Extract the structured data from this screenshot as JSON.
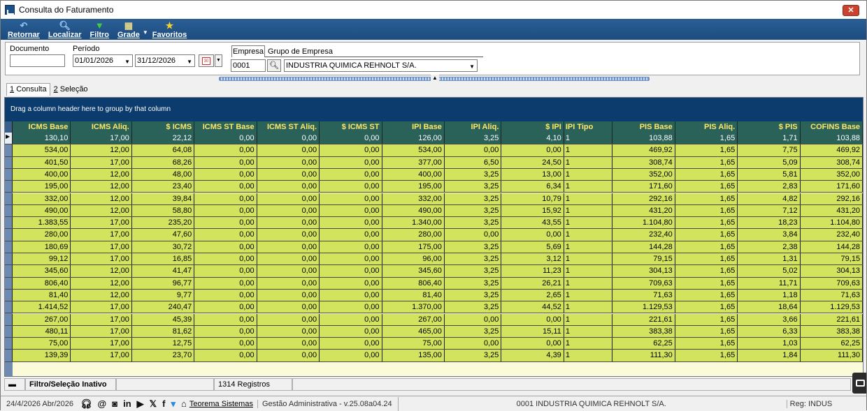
{
  "window": {
    "title": "Consulta do Faturamento",
    "close": "✕"
  },
  "toolbar": {
    "buttons": [
      {
        "label": "Retornar",
        "icon": "back-arrow-icon",
        "glyph": "↶"
      },
      {
        "label": "Localizar",
        "icon": "search-icon",
        "glyph": "🔍︎"
      },
      {
        "label": "Filtro",
        "icon": "filter-icon",
        "glyph": "▼"
      },
      {
        "label": "Grade",
        "icon": "grid-icon",
        "glyph": "▦"
      },
      {
        "label": "Favoritos",
        "icon": "star-icon",
        "glyph": "★"
      }
    ]
  },
  "filters": {
    "documento_label": "Documento",
    "documento_value": "",
    "periodo_label": "Período",
    "date_from": "01/01/2026",
    "date_to": "31/12/2026",
    "cal_day": "30",
    "tab_empresa": "Empresa",
    "tab_grupo": "Grupo de Empresa",
    "empresa_code": "0001",
    "empresa_name": "INDUSTRIA QUIMICA REHNOLT S/A."
  },
  "tabs": [
    {
      "num": "1",
      "label": "Consulta"
    },
    {
      "num": "2",
      "label": "Seleção"
    }
  ],
  "grid": {
    "group_hint": "Drag a column header here to group by that column",
    "columns": [
      "ICMS Base",
      "ICMS Aliq.",
      "$ ICMS",
      "ICMS ST Base",
      "ICMS ST Aliq.",
      "$ ICMS ST",
      "IPI Base",
      "IPI Aliq.",
      "$ IPI",
      "IPI Tipo",
      "PIS Base",
      "PIS Aliq.",
      "$ PIS",
      "COFINS Base"
    ],
    "rows": [
      [
        "130,10",
        "17,00",
        "22,12",
        "0,00",
        "0,00",
        "0,00",
        "126,00",
        "3,25",
        "4,10",
        "1",
        "103,88",
        "1,65",
        "1,71",
        "103,88"
      ],
      [
        "534,00",
        "12,00",
        "64,08",
        "0,00",
        "0,00",
        "0,00",
        "534,00",
        "0,00",
        "0,00",
        "1",
        "469,92",
        "1,65",
        "7,75",
        "469,92"
      ],
      [
        "401,50",
        "17,00",
        "68,26",
        "0,00",
        "0,00",
        "0,00",
        "377,00",
        "6,50",
        "24,50",
        "1",
        "308,74",
        "1,65",
        "5,09",
        "308,74"
      ],
      [
        "400,00",
        "12,00",
        "48,00",
        "0,00",
        "0,00",
        "0,00",
        "400,00",
        "3,25",
        "13,00",
        "1",
        "352,00",
        "1,65",
        "5,81",
        "352,00"
      ],
      [
        "195,00",
        "12,00",
        "23,40",
        "0,00",
        "0,00",
        "0,00",
        "195,00",
        "3,25",
        "6,34",
        "1",
        "171,60",
        "1,65",
        "2,83",
        "171,60"
      ],
      [
        "332,00",
        "12,00",
        "39,84",
        "0,00",
        "0,00",
        "0,00",
        "332,00",
        "3,25",
        "10,79",
        "1",
        "292,16",
        "1,65",
        "4,82",
        "292,16"
      ],
      [
        "490,00",
        "12,00",
        "58,80",
        "0,00",
        "0,00",
        "0,00",
        "490,00",
        "3,25",
        "15,92",
        "1",
        "431,20",
        "1,65",
        "7,12",
        "431,20"
      ],
      [
        "1.383,55",
        "17,00",
        "235,20",
        "0,00",
        "0,00",
        "0,00",
        "1.340,00",
        "3,25",
        "43,55",
        "1",
        "1.104,80",
        "1,65",
        "18,23",
        "1.104,80"
      ],
      [
        "280,00",
        "17,00",
        "47,60",
        "0,00",
        "0,00",
        "0,00",
        "280,00",
        "0,00",
        "0,00",
        "1",
        "232,40",
        "1,65",
        "3,84",
        "232,40"
      ],
      [
        "180,69",
        "17,00",
        "30,72",
        "0,00",
        "0,00",
        "0,00",
        "175,00",
        "3,25",
        "5,69",
        "1",
        "144,28",
        "1,65",
        "2,38",
        "144,28"
      ],
      [
        "99,12",
        "17,00",
        "16,85",
        "0,00",
        "0,00",
        "0,00",
        "96,00",
        "3,25",
        "3,12",
        "1",
        "79,15",
        "1,65",
        "1,31",
        "79,15"
      ],
      [
        "345,60",
        "12,00",
        "41,47",
        "0,00",
        "0,00",
        "0,00",
        "345,60",
        "3,25",
        "11,23",
        "1",
        "304,13",
        "1,65",
        "5,02",
        "304,13"
      ],
      [
        "806,40",
        "12,00",
        "96,77",
        "0,00",
        "0,00",
        "0,00",
        "806,40",
        "3,25",
        "26,21",
        "1",
        "709,63",
        "1,65",
        "11,71",
        "709,63"
      ],
      [
        "81,40",
        "12,00",
        "9,77",
        "0,00",
        "0,00",
        "0,00",
        "81,40",
        "3,25",
        "2,65",
        "1",
        "71,63",
        "1,65",
        "1,18",
        "71,63"
      ],
      [
        "1.414,52",
        "17,00",
        "240,47",
        "0,00",
        "0,00",
        "0,00",
        "1.370,00",
        "3,25",
        "44,52",
        "1",
        "1.129,53",
        "1,65",
        "18,64",
        "1.129,53"
      ],
      [
        "267,00",
        "17,00",
        "45,39",
        "0,00",
        "0,00",
        "0,00",
        "267,00",
        "0,00",
        "0,00",
        "1",
        "221,61",
        "1,65",
        "3,66",
        "221,61"
      ],
      [
        "480,11",
        "17,00",
        "81,62",
        "0,00",
        "0,00",
        "0,00",
        "465,00",
        "3,25",
        "15,11",
        "1",
        "383,38",
        "1,65",
        "6,33",
        "383,38"
      ],
      [
        "75,00",
        "17,00",
        "12,75",
        "0,00",
        "0,00",
        "0,00",
        "75,00",
        "0,00",
        "0,00",
        "1",
        "62,25",
        "1,65",
        "1,03",
        "62,25"
      ],
      [
        "139,39",
        "17,00",
        "23,70",
        "0,00",
        "0,00",
        "0,00",
        "135,00",
        "3,25",
        "4,39",
        "1",
        "111,30",
        "1,65",
        "1,84",
        "111,30"
      ]
    ]
  },
  "status_bar": {
    "filter_status": "Filtro/Seleção Inativo",
    "records": "1314 Registros"
  },
  "footer": {
    "date": "24/4/2026 Abr/2026",
    "company_link": "Teorema Sistemas",
    "version": "Gestão Administrativa - v.25.08a04.24",
    "empresa": "0001 INDUSTRIA QUIMICA REHNOLT S/A.",
    "reg": "Reg: INDUS"
  },
  "colors": {
    "accent": "#1d4c7e",
    "grid_header": "#2a6158",
    "row": "#d2e45e",
    "header_text": "#ffe86a"
  }
}
